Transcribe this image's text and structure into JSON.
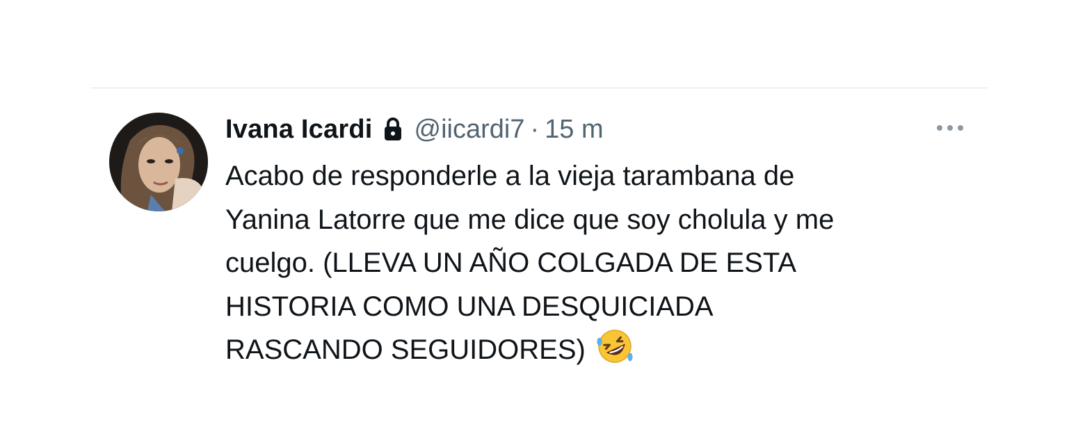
{
  "tweet": {
    "author_name": "Ivana Icardi",
    "handle": "@iicardi7",
    "separator": "·",
    "timestamp": "15 m",
    "text_lines": [
      "Acabo de responderle a la vieja tarambana de",
      "Yanina Latorre que me dice que soy cholula y me",
      "cuelgo. (LLEVA UN AÑO COLGADA DE ESTA",
      "HISTORIA COMO UNA DESQUICIADA",
      "RASCANDO SEGUIDORES)"
    ],
    "emoji_icon": "rolling-on-floor-laughing-emoji",
    "protected_icon": "lock-icon",
    "more_icon": "more-options-icon"
  },
  "colors": {
    "text_primary": "#0f1419",
    "text_secondary": "#536471",
    "divider": "#dfe3e6",
    "background": "#ffffff"
  }
}
